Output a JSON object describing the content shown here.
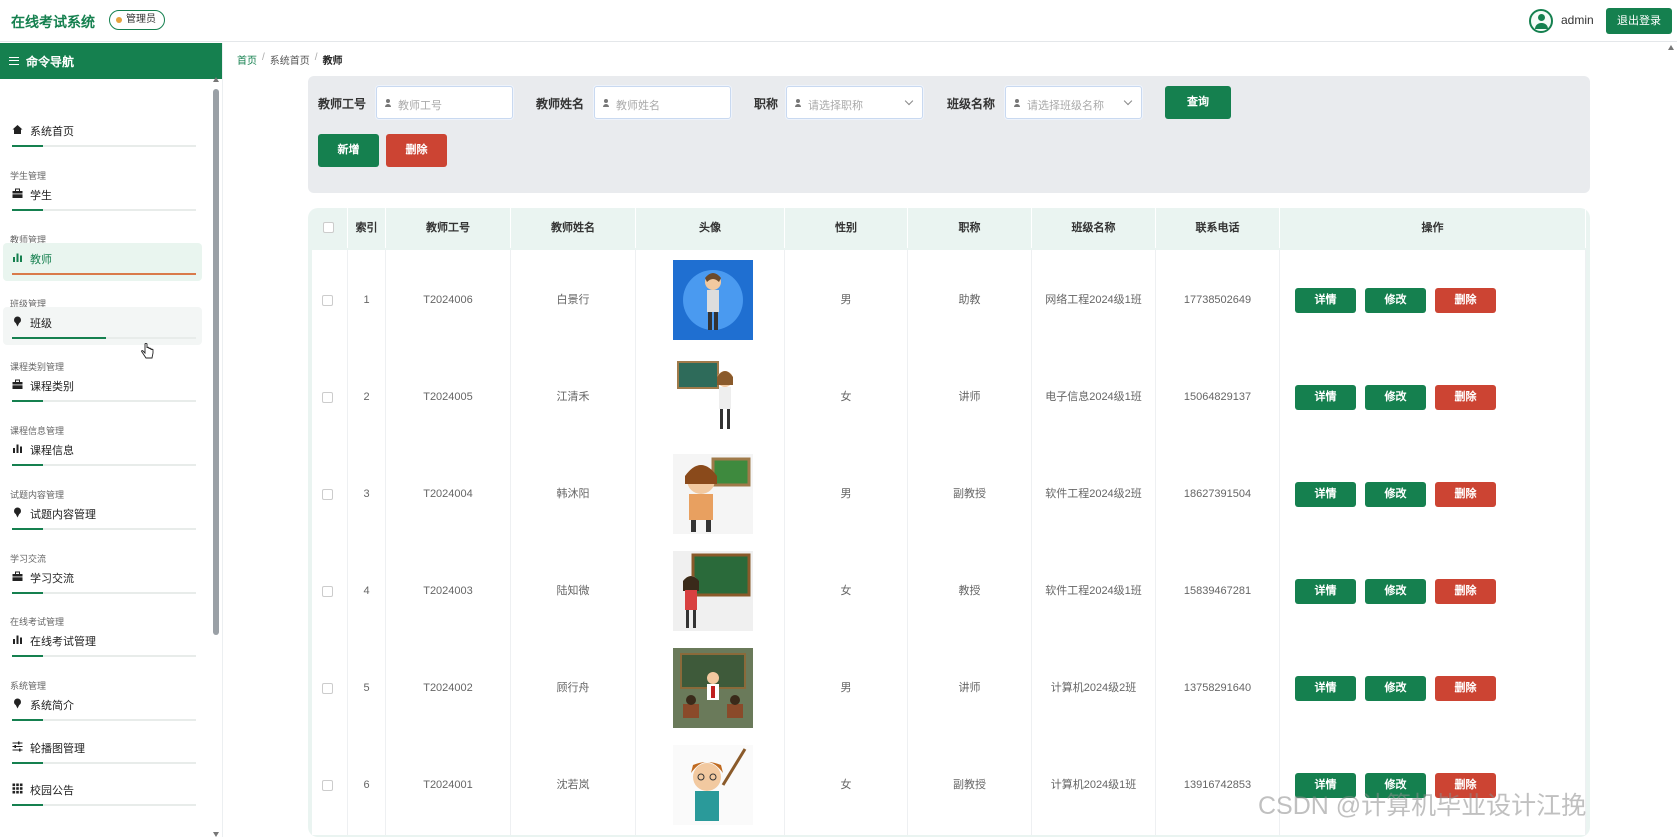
{
  "header": {
    "app_title": "在线考试系统",
    "role_badge": "管理员",
    "username": "admin",
    "logout": "退出登录"
  },
  "sidebar": {
    "title": "命令导航",
    "items": [
      {
        "group": "",
        "label": "系统首页",
        "icon": "home-icon",
        "progress": 0.17,
        "active": false
      },
      {
        "group": "学生管理",
        "label": "学生",
        "icon": "briefcase-icon",
        "progress": 0.17,
        "active": false
      },
      {
        "group": "教师管理",
        "label": "教师",
        "icon": "bar-chart-icon",
        "progress": 1.0,
        "active": true
      },
      {
        "group": "班级管理",
        "label": "班级",
        "icon": "pin-icon",
        "progress": 0.51,
        "active": false,
        "hover": true
      },
      {
        "group": "课程类别管理",
        "label": "课程类别",
        "icon": "briefcase-icon",
        "progress": 0.17,
        "active": false
      },
      {
        "group": "课程信息管理",
        "label": "课程信息",
        "icon": "bar-chart-icon",
        "progress": 0.17,
        "active": false
      },
      {
        "group": "试题内容管理",
        "label": "试题内容管理",
        "icon": "pin-icon",
        "progress": 0.17,
        "active": false
      },
      {
        "group": "学习交流",
        "label": "学习交流",
        "icon": "briefcase-icon",
        "progress": 0.17,
        "active": false
      },
      {
        "group": "在线考试管理",
        "label": "在线考试管理",
        "icon": "bar-chart-icon",
        "progress": 0.17,
        "active": false
      },
      {
        "group": "系统管理",
        "label": "系统简介",
        "icon": "pin-icon",
        "progress": 0.17,
        "active": false
      },
      {
        "group": "",
        "label": "轮播图管理",
        "icon": "sliders-icon",
        "progress": 0.17,
        "active": false
      },
      {
        "group": "",
        "label": "校园公告",
        "icon": "grid-icon",
        "progress": 0.17,
        "active": false
      }
    ]
  },
  "breadcrumb": {
    "home": "首页",
    "sys_home": "系统首页",
    "current": "教师",
    "sep": "/"
  },
  "filters": {
    "teacher_id_label": "教师工号",
    "teacher_id_placeholder": "教师工号",
    "teacher_name_label": "教师姓名",
    "teacher_name_placeholder": "教师姓名",
    "title_label": "职称",
    "title_placeholder": "请选择职称",
    "class_label": "班级名称",
    "class_placeholder": "请选择班级名称",
    "search": "查询",
    "add": "新增",
    "delete": "删除"
  },
  "table": {
    "columns": [
      "索引",
      "教师工号",
      "教师姓名",
      "头像",
      "性别",
      "职称",
      "班级名称",
      "联系电话",
      "操作"
    ],
    "rows": [
      {
        "index": "1",
        "id": "T2024006",
        "name": "白景行",
        "gender": "男",
        "title": "助教",
        "class": "网络工程2024级1班",
        "phone": "17738502649"
      },
      {
        "index": "2",
        "id": "T2024005",
        "name": "江清禾",
        "gender": "女",
        "title": "讲师",
        "class": "电子信息2024级1班",
        "phone": "15064829137"
      },
      {
        "index": "3",
        "id": "T2024004",
        "name": "韩沐阳",
        "gender": "男",
        "title": "副教授",
        "class": "软件工程2024级2班",
        "phone": "18627391504"
      },
      {
        "index": "4",
        "id": "T2024003",
        "name": "陆知微",
        "gender": "女",
        "title": "教授",
        "class": "软件工程2024级1班",
        "phone": "15839467281"
      },
      {
        "index": "5",
        "id": "T2024002",
        "name": "顾行舟",
        "gender": "男",
        "title": "讲师",
        "class": "计算机2024级2班",
        "phone": "13758291640"
      },
      {
        "index": "6",
        "id": "T2024001",
        "name": "沈若岚",
        "gender": "女",
        "title": "副教授",
        "class": "计算机2024级1班",
        "phone": "13916742853"
      }
    ],
    "actions": {
      "detail": "详情",
      "edit": "修改",
      "delete": "删除"
    }
  },
  "watermark": "CSDN @计算机毕业设计江挽",
  "colors": {
    "primary": "#15804f",
    "danger": "#cc4433",
    "header_bg": "#eaf4f1"
  }
}
